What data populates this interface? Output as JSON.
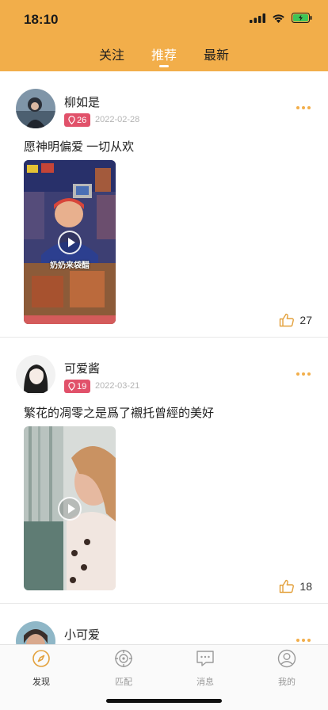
{
  "status_bar": {
    "time": "18:10"
  },
  "top_tabs": [
    {
      "label": "关注",
      "active": false
    },
    {
      "label": "推荐",
      "active": true
    },
    {
      "label": "最新",
      "active": false
    }
  ],
  "posts": [
    {
      "username": "柳如是",
      "level": "26",
      "date": "2022-02-28",
      "caption": "愿神明偏爱 一切从欢",
      "video_overlay_text": "奶奶来袋醋",
      "likes": "27"
    },
    {
      "username": "可爱酱",
      "level": "19",
      "date": "2022-03-21",
      "caption": "繁花的凋零之是爲了襯托曾經的美好",
      "likes": "18"
    },
    {
      "username": "小可爱"
    }
  ],
  "bottom_nav": [
    {
      "label": "发现",
      "icon": "compass-icon",
      "active": true
    },
    {
      "label": "匹配",
      "icon": "target-icon",
      "active": false
    },
    {
      "label": "消息",
      "icon": "chat-icon",
      "active": false
    },
    {
      "label": "我的",
      "icon": "profile-icon",
      "active": false
    }
  ],
  "colors": {
    "accent": "#f2ae4a",
    "badge": "#e1516a"
  }
}
